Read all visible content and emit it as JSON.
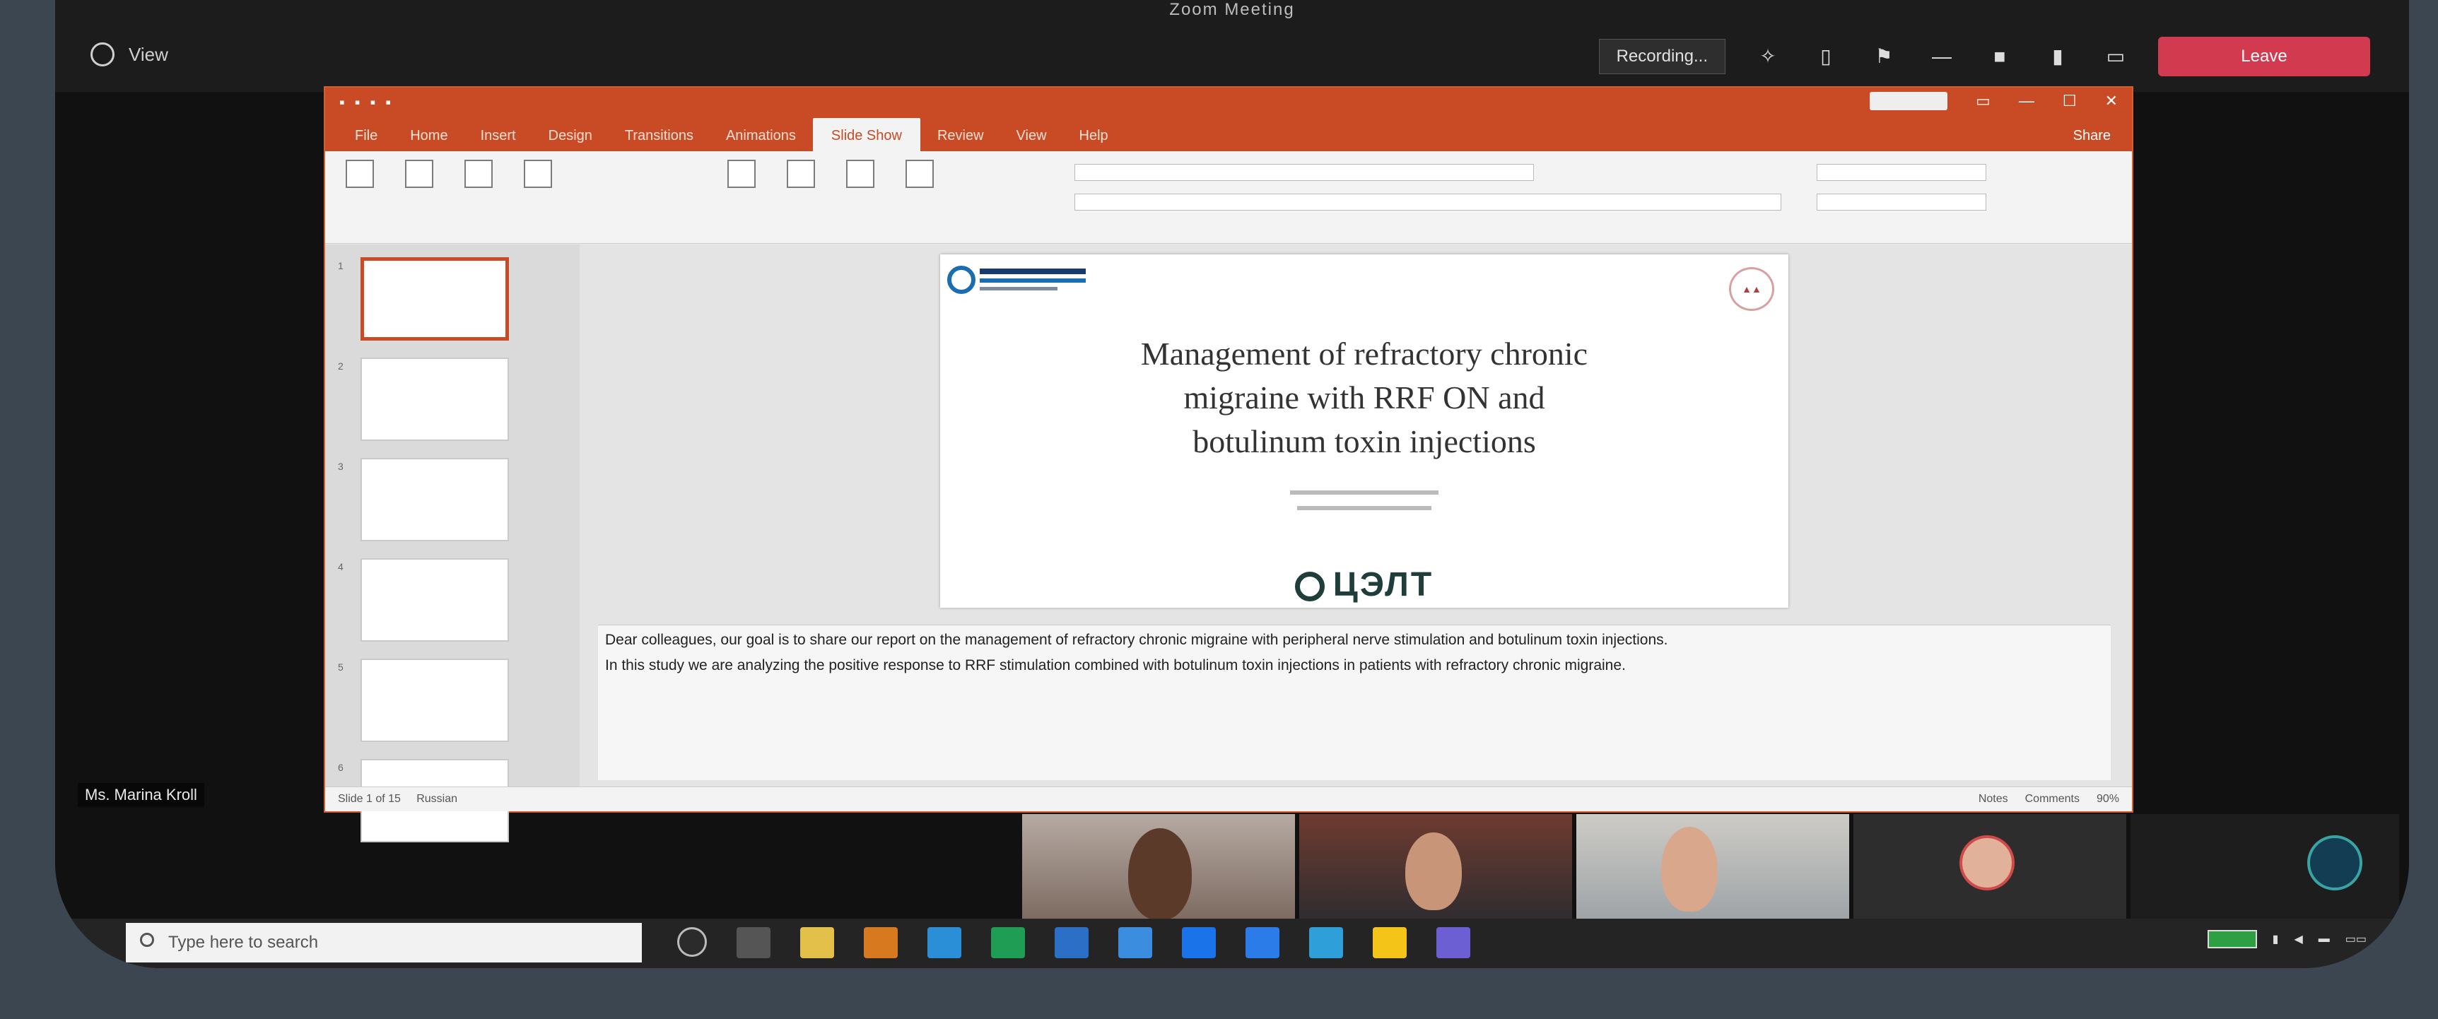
{
  "meeting": {
    "title": "Zoom Meeting",
    "view_label": "View",
    "record_label": "Recording...",
    "leave_label": "Leave"
  },
  "ppt": {
    "tabs": [
      "File",
      "Home",
      "Insert",
      "Design",
      "Transitions",
      "Animations",
      "Slide Show",
      "Review",
      "View",
      "Help"
    ],
    "active_tab": 6,
    "share_label": "Share",
    "slides_count": 6
  },
  "slide": {
    "title_lines": [
      "Management of refractory chronic",
      "migraine with RRF ON and",
      "botulinum toxin injections"
    ],
    "footer_logo": "ЦЭЛТ"
  },
  "notes": {
    "paragraphs": [
      "Dear colleagues, our goal is to share our report on the management of refractory chronic migraine with peripheral nerve stimulation and botulinum toxin injections.",
      "In this study we are analyzing the positive response to RRF stimulation combined with botulinum toxin injections in patients with refractory chronic migraine."
    ]
  },
  "status": {
    "slide_info": "Slide 1 of 15",
    "language": "Russian",
    "notes_label": "Notes",
    "comments_label": "Comments",
    "zoom": "90%"
  },
  "speaker": {
    "label": "Ms. Marina Kroll"
  },
  "participants": [
    {
      "name": ""
    },
    {
      "name": ""
    },
    {
      "name": ""
    },
    {
      "name": ""
    },
    {
      "name": ""
    }
  ],
  "taskbar": {
    "search_placeholder": "Type here to search"
  },
  "colors": {
    "ppt_accent": "#c84b25",
    "leave": "#d23b4f",
    "background": "#3c4650"
  }
}
